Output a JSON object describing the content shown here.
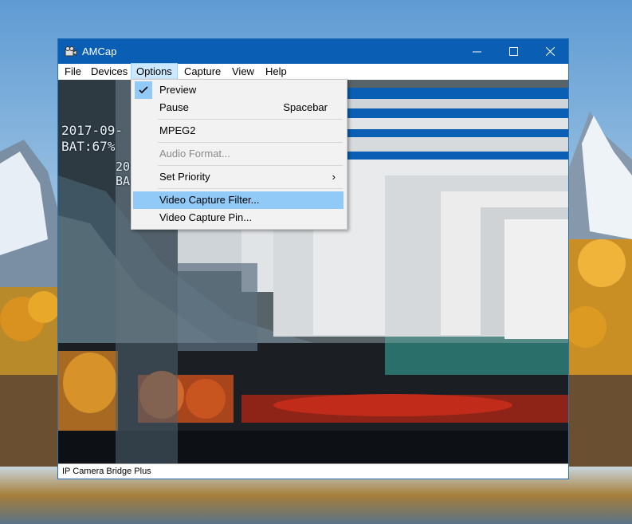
{
  "window": {
    "title": "AMCap",
    "icon": "camera-icon",
    "controls": {
      "minimize": "minimize-icon",
      "maximize": "maximize-icon",
      "close": "close-icon"
    }
  },
  "menubar": [
    "File",
    "Devices",
    "Options",
    "Capture",
    "View",
    "Help"
  ],
  "preview": {
    "osd_line1": "2017-09-",
    "osd_line2": "BAT:67%",
    "echo_line1": "20",
    "echo_line2": "BA"
  },
  "options_menu": {
    "preview": "Preview",
    "pause": "Pause",
    "pause_shortcut": "Spacebar",
    "mpeg2": "MPEG2",
    "audio_format": "Audio Format...",
    "set_priority": "Set Priority",
    "video_capture_filter": "Video Capture Filter...",
    "video_capture_pin": "Video Capture Pin..."
  },
  "status": "IP Camera Bridge Plus",
  "colors": {
    "titlebar": "#0a5fb4",
    "highlight": "#91c9f7",
    "menu_active": "#cce8ff"
  }
}
